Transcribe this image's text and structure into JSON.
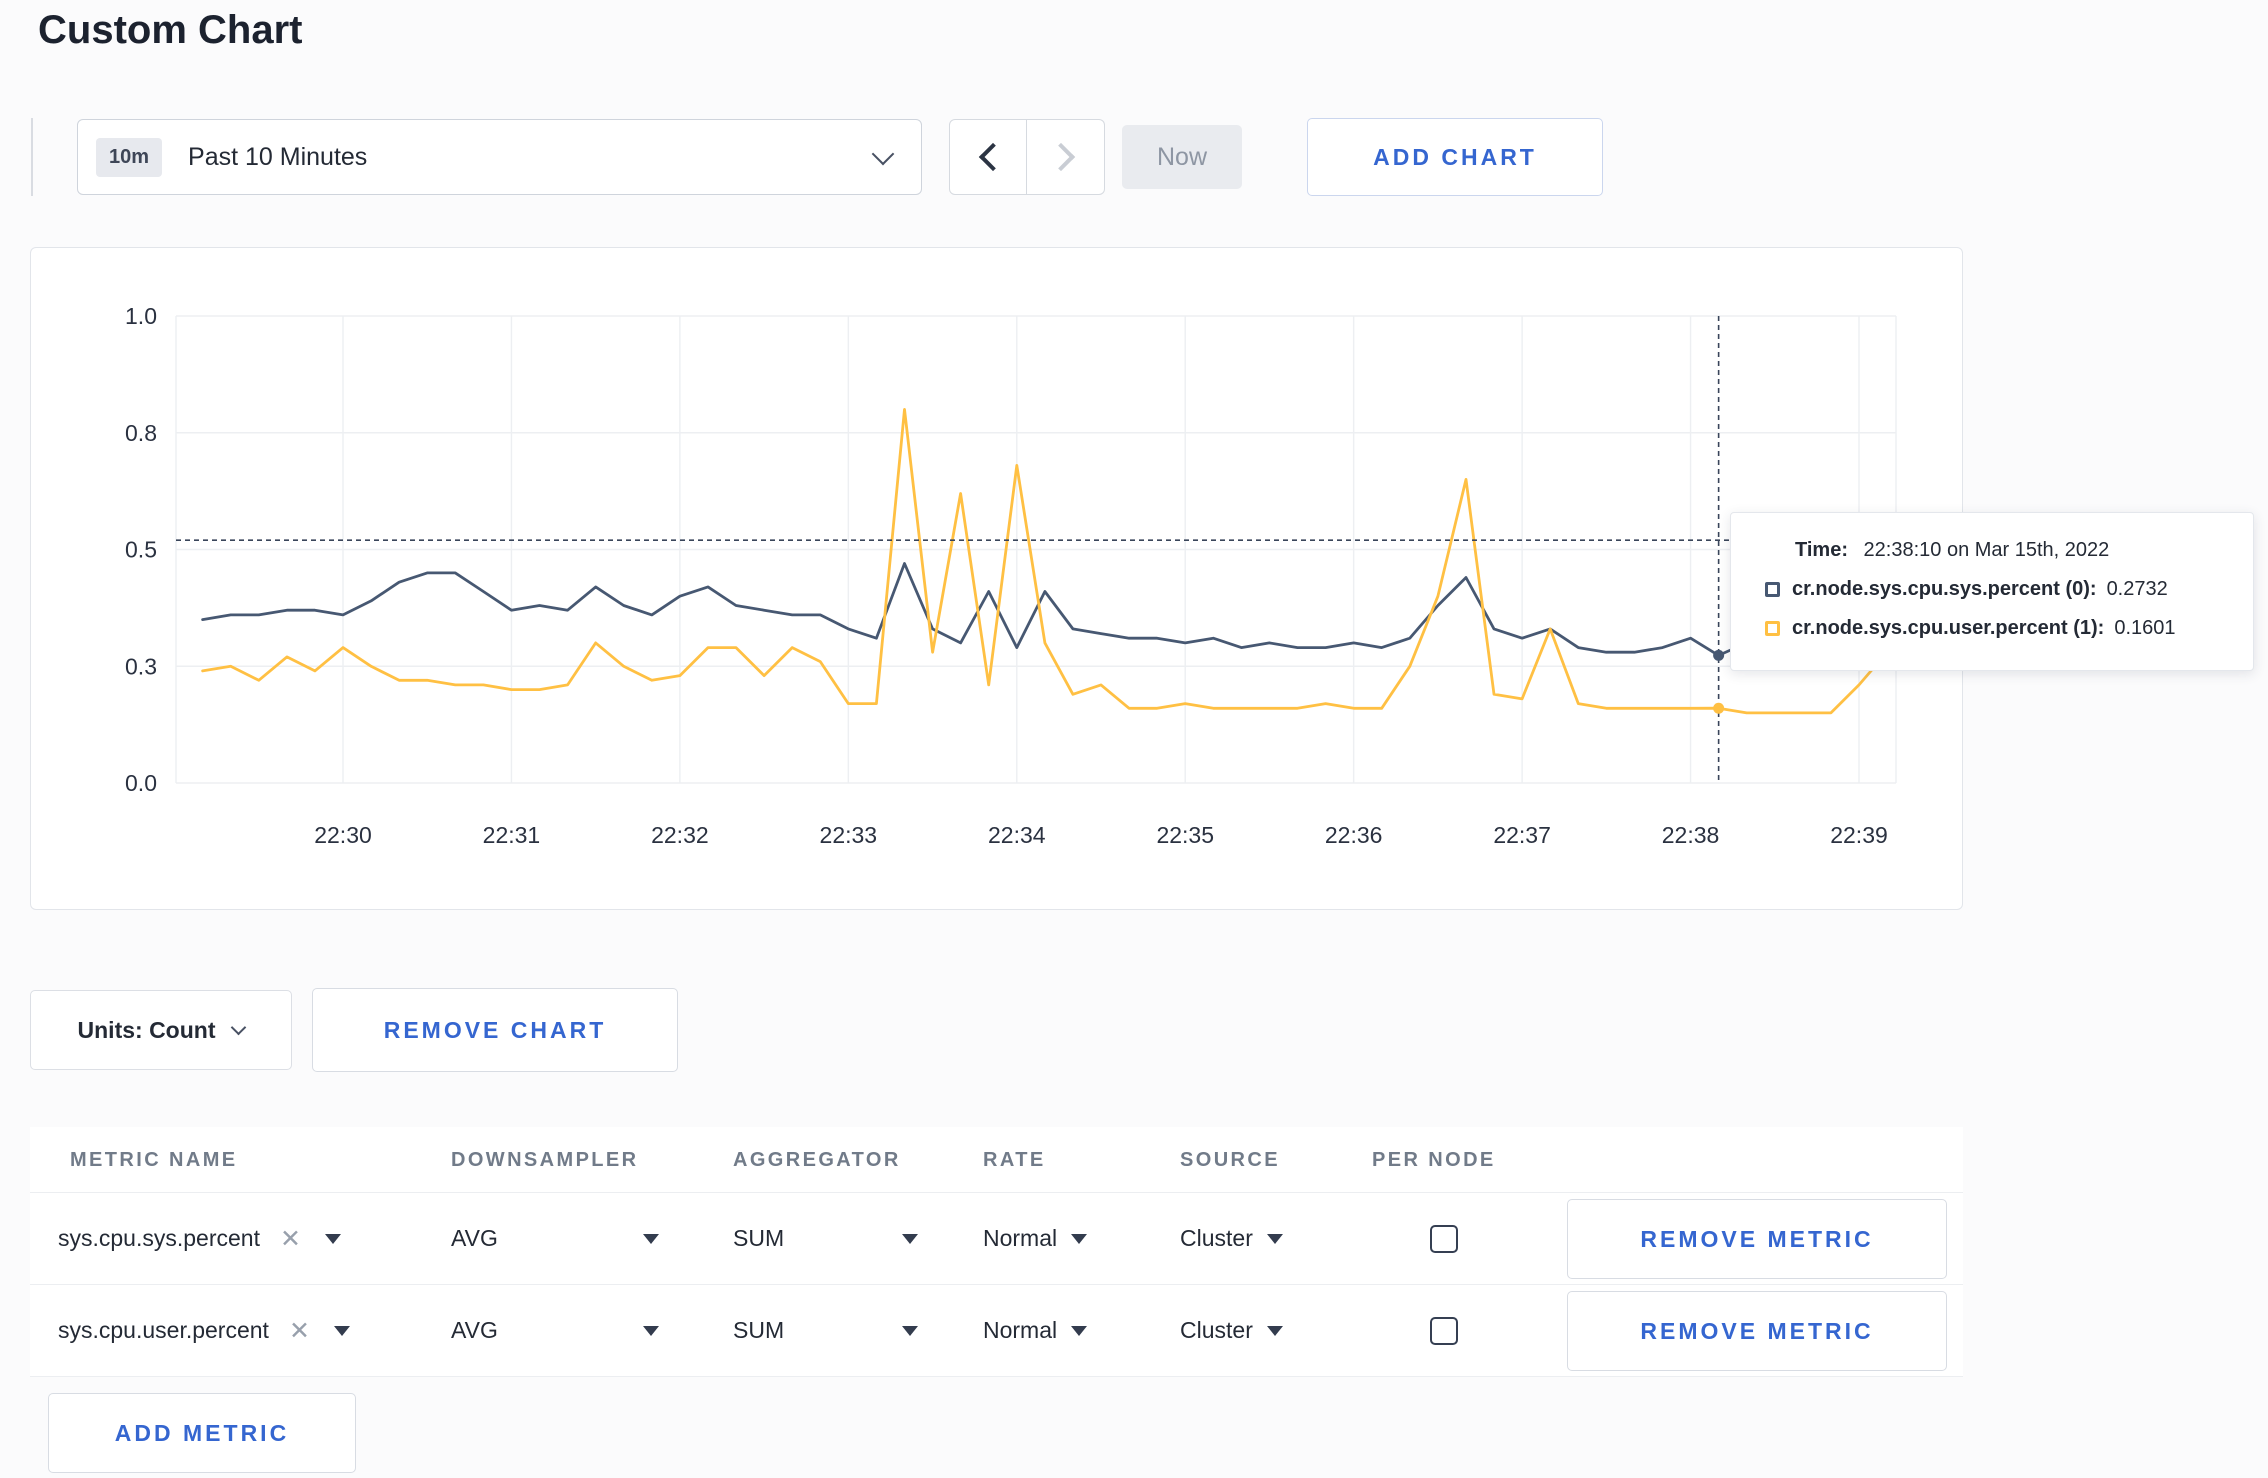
{
  "header": {
    "title": "Custom Chart"
  },
  "toolbar": {
    "time_badge": "10m",
    "time_label": "Past 10 Minutes",
    "now_label": "Now",
    "add_chart_label": "ADD CHART"
  },
  "chart_controls": {
    "units_label": "Units: Count",
    "remove_chart_label": "REMOVE CHART",
    "add_metric_label": "ADD METRIC"
  },
  "tooltip": {
    "time_label": "Time:",
    "time_value": "22:38:10 on Mar 15th, 2022",
    "series": [
      {
        "label": "cr.node.sys.cpu.sys.percent (0):",
        "value": "0.2732",
        "color": "#475872"
      },
      {
        "label": "cr.node.sys.cpu.user.percent (1):",
        "value": "0.1601",
        "color": "#ffc043"
      }
    ]
  },
  "metrics_table": {
    "columns": [
      "METRIC NAME",
      "DOWNSAMPLER",
      "AGGREGATOR",
      "RATE",
      "SOURCE",
      "PER NODE"
    ],
    "remove_metric_label": "REMOVE METRIC",
    "rows": [
      {
        "name": "sys.cpu.sys.percent",
        "downsampler": "AVG",
        "aggregator": "SUM",
        "rate": "Normal",
        "source": "Cluster",
        "per_node_checked": false
      },
      {
        "name": "sys.cpu.user.percent",
        "downsampler": "AVG",
        "aggregator": "SUM",
        "rate": "Normal",
        "source": "Cluster",
        "per_node_checked": false
      }
    ]
  },
  "colors": {
    "accent_blue": "#3566d0",
    "series_sys": "#475872",
    "series_user": "#ffc043",
    "grid": "#edeff2",
    "crosshair": "#39455a"
  },
  "chart_data": {
    "type": "line",
    "title": "",
    "xlabel": "",
    "ylabel": "",
    "ylim": [
      0,
      1
    ],
    "grid": true,
    "legend_position": "tooltip",
    "y_tick_labels": [
      "0.0",
      "0.3",
      "0.5",
      "0.8",
      "1.0"
    ],
    "y_tick_positions": [
      0,
      0.25,
      0.5,
      0.75,
      1
    ],
    "x_ticks": [
      "22:30",
      "22:31",
      "22:32",
      "22:33",
      "22:34",
      "22:35",
      "22:36",
      "22:37",
      "22:38",
      "22:39"
    ],
    "x_start_time": "22:29:10",
    "x_step_seconds": 10,
    "x_start_offset_seconds": -50,
    "series": [
      {
        "name": "cr.node.sys.cpu.sys.percent",
        "color": "#475872",
        "values": [
          0.35,
          0.36,
          0.36,
          0.37,
          0.37,
          0.36,
          0.39,
          0.43,
          0.45,
          0.45,
          0.41,
          0.37,
          0.38,
          0.37,
          0.42,
          0.38,
          0.36,
          0.4,
          0.42,
          0.38,
          0.37,
          0.36,
          0.36,
          0.33,
          0.31,
          0.47,
          0.33,
          0.3,
          0.41,
          0.29,
          0.41,
          0.33,
          0.32,
          0.31,
          0.31,
          0.3,
          0.31,
          0.29,
          0.3,
          0.29,
          0.29,
          0.3,
          0.29,
          0.31,
          0.38,
          0.44,
          0.33,
          0.31,
          0.33,
          0.29,
          0.28,
          0.28,
          0.29,
          0.31,
          0.2732,
          0.3,
          0.29,
          0.3,
          0.31,
          0.3,
          0.31
        ]
      },
      {
        "name": "cr.node.sys.cpu.user.percent",
        "color": "#ffc043",
        "values": [
          0.24,
          0.25,
          0.22,
          0.27,
          0.24,
          0.29,
          0.25,
          0.22,
          0.22,
          0.21,
          0.21,
          0.2,
          0.2,
          0.21,
          0.3,
          0.25,
          0.22,
          0.23,
          0.29,
          0.29,
          0.23,
          0.29,
          0.26,
          0.17,
          0.17,
          0.8,
          0.28,
          0.62,
          0.21,
          0.68,
          0.3,
          0.19,
          0.21,
          0.16,
          0.16,
          0.17,
          0.16,
          0.16,
          0.16,
          0.16,
          0.17,
          0.16,
          0.16,
          0.25,
          0.4,
          0.65,
          0.19,
          0.18,
          0.33,
          0.17,
          0.16,
          0.16,
          0.16,
          0.16,
          0.1601,
          0.15,
          0.15,
          0.15,
          0.15,
          0.21,
          0.28
        ]
      }
    ],
    "crosshair": {
      "index": 54,
      "time": "22:38:10",
      "y_value": 0.52
    }
  }
}
